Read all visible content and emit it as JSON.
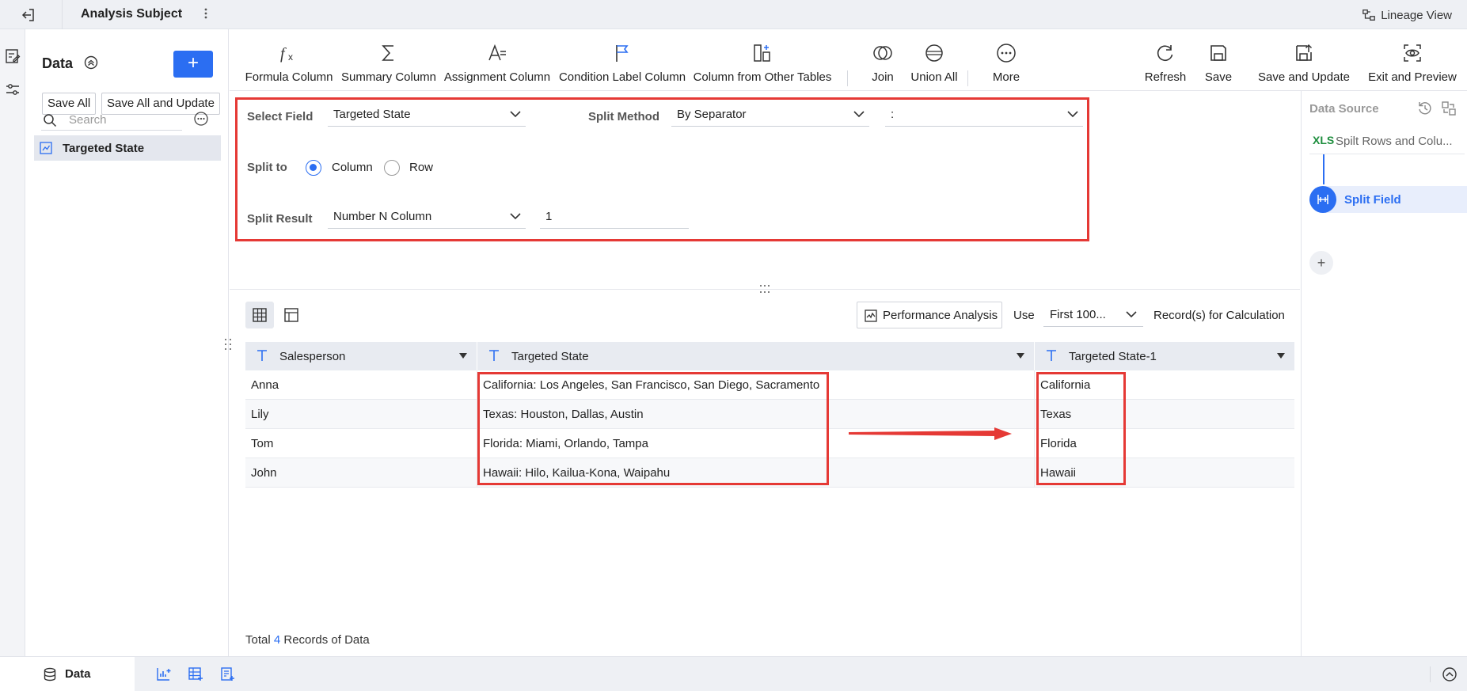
{
  "app": {
    "title": "Analysis Subject",
    "lineage_view": "Lineage View"
  },
  "data_panel": {
    "heading": "Data",
    "save_all": "Save All",
    "save_all_update": "Save All and Update",
    "search_placeholder": "Search",
    "items": [
      {
        "label": "Targeted State"
      }
    ]
  },
  "toolbar": {
    "items": [
      {
        "label": "Formula Column",
        "icon": "formula-icon"
      },
      {
        "label": "Summary Column",
        "icon": "sigma-icon"
      },
      {
        "label": "Assignment Column",
        "icon": "assignment-icon"
      },
      {
        "label": "Condition Label Column",
        "icon": "flag-icon"
      },
      {
        "label": "Column from Other Tables",
        "icon": "column-add-icon"
      },
      {
        "label": "Join",
        "icon": "join-icon"
      },
      {
        "label": "Union All",
        "icon": "union-icon"
      },
      {
        "label": "More",
        "icon": "more-icon"
      },
      {
        "label": "Refresh",
        "icon": "refresh-icon"
      },
      {
        "label": "Save",
        "icon": "save-icon"
      },
      {
        "label": "Save and Update",
        "icon": "save-update-icon"
      },
      {
        "label": "Exit and Preview",
        "icon": "preview-icon"
      }
    ]
  },
  "config": {
    "select_field_label": "Select Field",
    "select_field_value": "Targeted State",
    "split_method_label": "Split Method",
    "split_method_value": "By Separator",
    "separator_value": ":",
    "split_to_label": "Split to",
    "split_to_options": [
      "Column",
      "Row"
    ],
    "split_to_selected": "Column",
    "split_result_label": "Split Result",
    "split_result_value": "Number N Column",
    "split_result_n": "1"
  },
  "grid_toolbar": {
    "perf_label": "Performance Analysis",
    "use_label": "Use",
    "use_value": "First 100...",
    "records_label": "Record(s) for Calculation"
  },
  "table": {
    "columns": [
      "Salesperson",
      "Targeted State",
      "Targeted State-1"
    ],
    "rows": [
      [
        "Anna",
        "California: Los Angeles, San Francisco, San Diego, Sacramento",
        "California"
      ],
      [
        "Lily",
        "Texas: Houston, Dallas, Austin",
        "Texas"
      ],
      [
        "Tom",
        "Florida: Miami, Orlando, Tampa",
        "Florida"
      ],
      [
        "John",
        "Hawaii: Hilo, Kailua-Kona, Waipahu",
        "Hawaii"
      ]
    ]
  },
  "footer": {
    "total_prefix": "Total",
    "total_count": "4",
    "total_suffix": "Records of Data"
  },
  "right_panel": {
    "data_source_label": "Data Source",
    "source_badge": "XLS",
    "source_node": "Spilt Rows and Colu...",
    "step_node": "Split Field"
  },
  "bottom_bar": {
    "tab_label": "Data"
  },
  "colors": {
    "accent": "#2b6ef2",
    "highlight": "#e53935"
  }
}
